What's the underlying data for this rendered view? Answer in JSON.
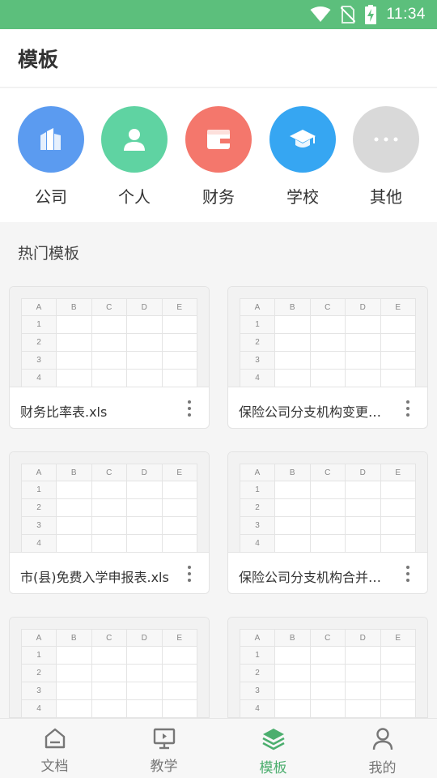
{
  "status_bar": {
    "time": "11:34"
  },
  "header": {
    "title": "模板"
  },
  "categories": [
    {
      "label": "公司",
      "icon": "building-icon",
      "color": "#5b9bf0"
    },
    {
      "label": "个人",
      "icon": "person-icon",
      "color": "#5fd3a2"
    },
    {
      "label": "财务",
      "icon": "wallet-icon",
      "color": "#f4776c"
    },
    {
      "label": "学校",
      "icon": "graduation-cap-icon",
      "color": "#36a6f2"
    },
    {
      "label": "其他",
      "icon": "more-dots-icon",
      "color": "#d9d9d9"
    }
  ],
  "section": {
    "title": "热门模板"
  },
  "spreadsheet_preview": {
    "columns": [
      "A",
      "B",
      "C",
      "D",
      "E"
    ],
    "rows": [
      "1",
      "2",
      "3",
      "4"
    ]
  },
  "templates": [
    {
      "name": "财务比率表.xls"
    },
    {
      "name": "保险公司分支机构变更报告表.xls"
    },
    {
      "name": "市(县)免费入学申报表.xls"
    },
    {
      "name": "保险公司分支机构合并报告表.xls"
    },
    {
      "name": ""
    },
    {
      "name": ""
    }
  ],
  "bottom_nav": [
    {
      "label": "文档",
      "icon": "home-icon",
      "active": false
    },
    {
      "label": "教学",
      "icon": "presentation-icon",
      "active": false
    },
    {
      "label": "模板",
      "icon": "layers-icon",
      "active": true
    },
    {
      "label": "我的",
      "icon": "user-icon",
      "active": false
    }
  ],
  "colors": {
    "accent": "#4cae6e",
    "status_bar": "#5cbf7c"
  }
}
